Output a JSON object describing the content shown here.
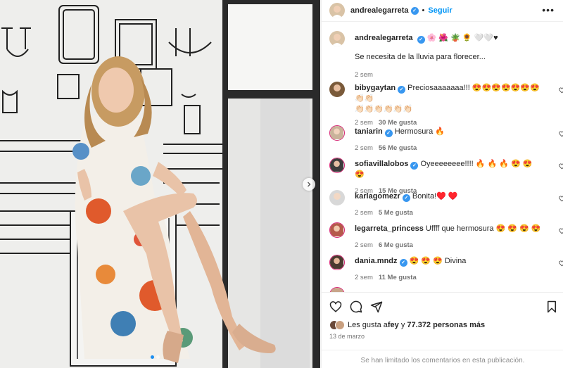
{
  "post": {
    "username": "andrealegarreta",
    "follow_label": "Seguir",
    "more_label": "•••",
    "caption_suffix": "🌸 🌺 🪴 🌻 🤍🤍♥",
    "caption": "Se necesita de la lluvia para florecer...",
    "caption_age": "2 sem"
  },
  "comments": [
    {
      "username": "bibygaytan",
      "verified": true,
      "text": "Preciosaaaaaaa!!! 😍😍😍😍😍😍😍👏🏻👏🏻",
      "text2": "👏🏻👏🏻👏🏻👏🏻👏🏻👏🏻",
      "age": "2 sem",
      "likes": "30 Me gusta",
      "reply": ""
    },
    {
      "username": "taniarin",
      "verified": true,
      "text": "Hermosura 🔥",
      "age": "2 sem",
      "likes": "56 Me gusta",
      "reply": ""
    },
    {
      "username": "sofiavillalobos",
      "verified": true,
      "text": "Oyeeeeeeee!!!! 🔥 🔥 🔥 😍 😍 😍",
      "age": "2 sem",
      "likes": "15 Me gusta",
      "reply": ""
    },
    {
      "username": "karlagomezr",
      "verified": true,
      "text": "Bonita!♥️ ♥️",
      "age": "2 sem",
      "likes": "5 Me gusta",
      "reply": ""
    },
    {
      "username": "legarreta_princess",
      "verified": false,
      "text": "Uffff que hermosura 😍 😍 😍 😍",
      "age": "2 sem",
      "likes": "6 Me gusta",
      "reply": ""
    },
    {
      "username": "dania.mndz",
      "verified": true,
      "text": "😍 😍 😍 Divina",
      "age": "2 sem",
      "likes": "11 Me gusta",
      "reply": ""
    }
  ],
  "likes_summary": {
    "prefix": "Les gusta a ",
    "user": "fey",
    "middle": " y ",
    "count": "77.372 personas más"
  },
  "date": "13 de marzo",
  "comments_limited": "Se han limitado los comentarios en esta publicación.",
  "icons": [
    "heart-icon",
    "comment-icon",
    "share-icon",
    "bookmark-icon",
    "verified-badge",
    "more-icon",
    "chevron-right-icon"
  ],
  "colors": {
    "accent": "#0095f6",
    "verified": "#3897f0",
    "muted": "#737373",
    "border": "#efefef"
  }
}
